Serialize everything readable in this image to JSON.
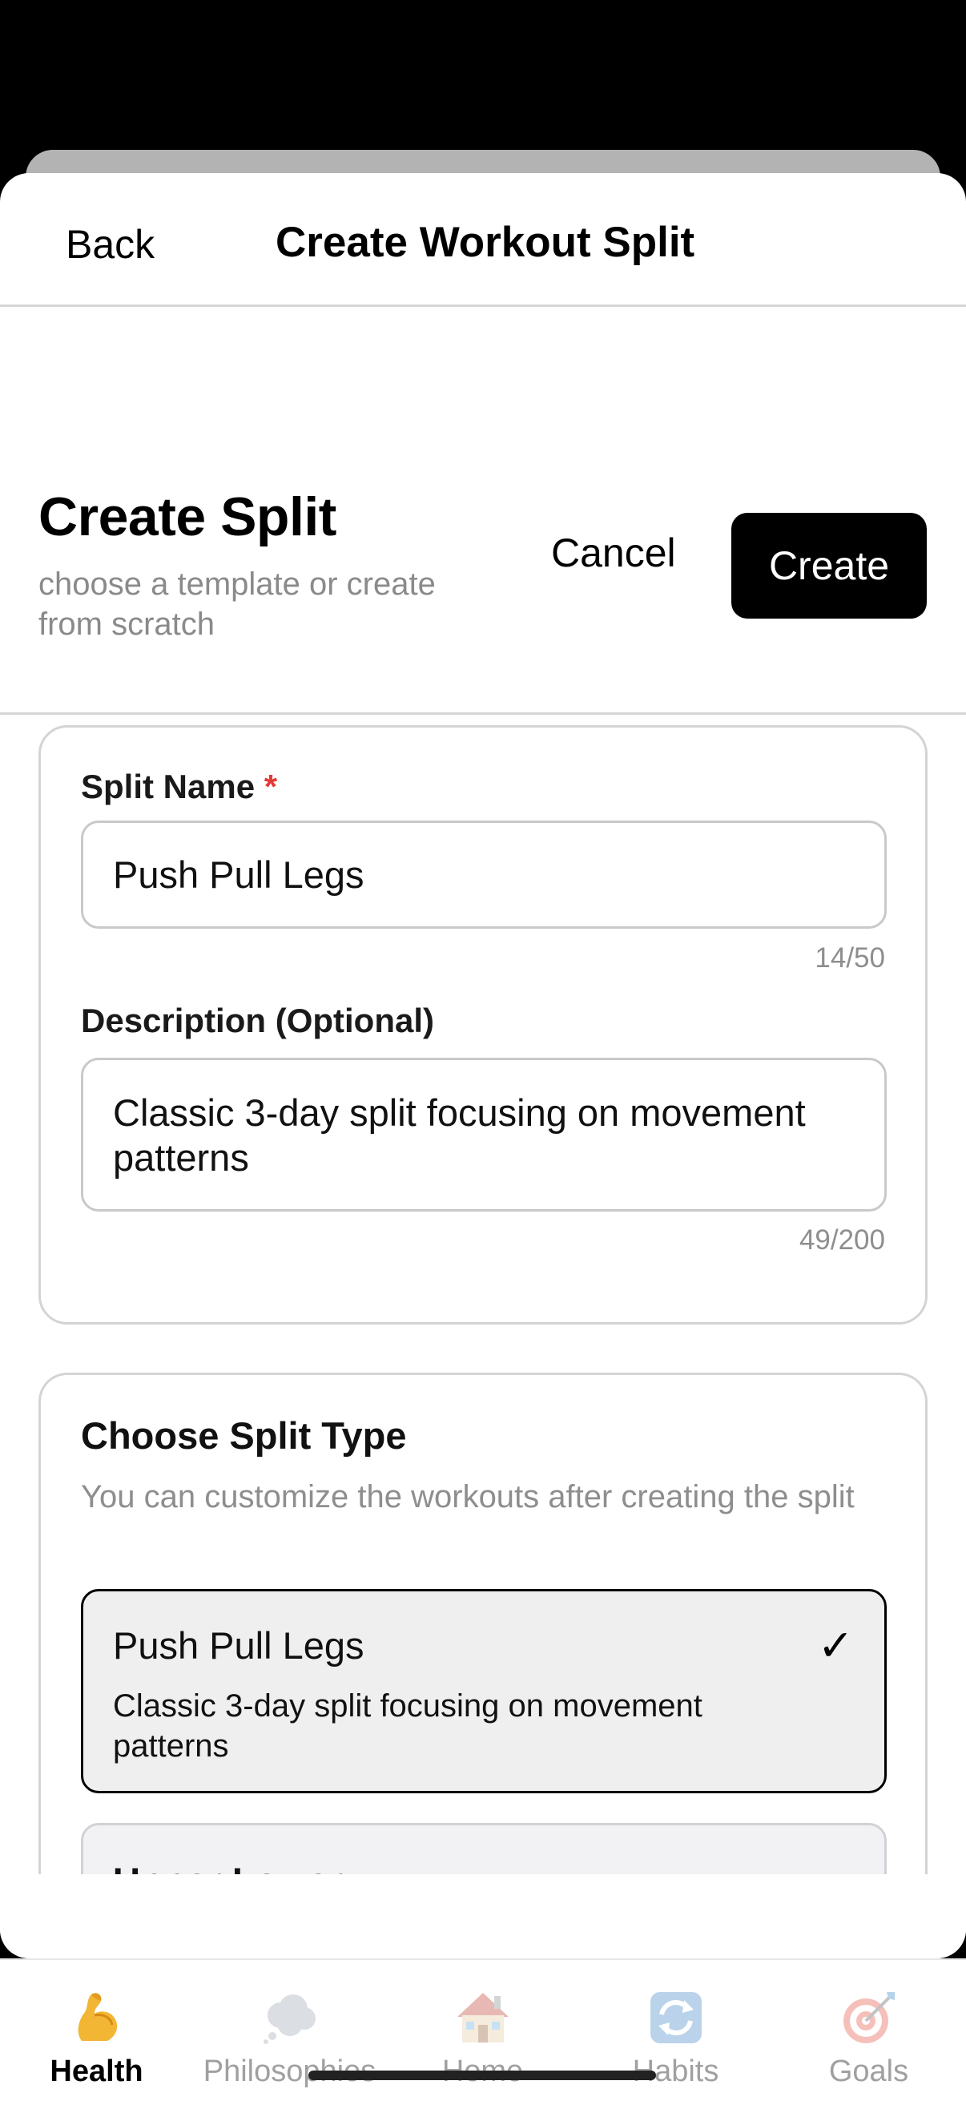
{
  "nav": {
    "back_label": "Back",
    "title": "Create Workout Split"
  },
  "header": {
    "title": "Create Split",
    "subtitle": "choose a template or create from scratch",
    "cancel_label": "Cancel",
    "create_label": "Create"
  },
  "form": {
    "name_label": "Split Name",
    "required_marker": "*",
    "name_value": "Push Pull Legs",
    "name_counter": "14/50",
    "desc_label": "Description (Optional)",
    "desc_value": "Classic 3-day split focusing on movement patterns",
    "desc_counter": "49/200"
  },
  "split_type": {
    "title": "Choose Split Type",
    "subtitle": "You can customize the workouts after creating the split",
    "options": [
      {
        "name": "Push Pull Legs",
        "description": "Classic 3-day split focusing on movement patterns",
        "selected": true,
        "check": "✓"
      },
      {
        "name": "Upper Lower",
        "selected": false
      }
    ]
  },
  "tabs": [
    {
      "label": "Health",
      "icon": "flexed-biceps-icon",
      "active": true
    },
    {
      "label": "Philosophies",
      "icon": "thought-cloud-icon",
      "active": false
    },
    {
      "label": "Home",
      "icon": "house-icon",
      "active": false
    },
    {
      "label": "Habits",
      "icon": "repeat-arrows-icon",
      "active": false
    },
    {
      "label": "Goals",
      "icon": "dart-target-icon",
      "active": false
    }
  ],
  "colors": {
    "accent": "#000000",
    "required": "#e53935",
    "muted_text": "#8e8e8e",
    "selected_bg": "#efefef"
  }
}
